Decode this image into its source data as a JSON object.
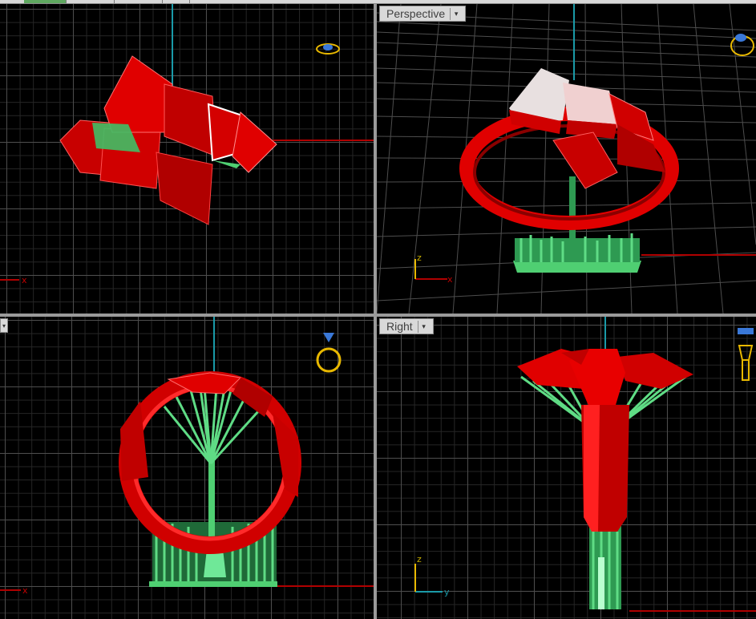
{
  "viewports": {
    "top": {
      "label": ""
    },
    "perspective": {
      "label": "Perspective"
    },
    "front": {
      "label": ""
    },
    "right": {
      "label": "Right"
    }
  },
  "axis_labels": {
    "x": "x",
    "y": "y",
    "z": "z"
  },
  "colors": {
    "model": "#e00000",
    "supports": "#4fcf72",
    "x_axis": "#b00000",
    "z_axis": "#1a9aa8",
    "gumball_gold": "#e8b800",
    "gumball_blue": "#3a78d8",
    "grid": "#4d4d4d"
  },
  "icons": [
    "ring-preview-icon",
    "dropdown-arrow-icon"
  ]
}
